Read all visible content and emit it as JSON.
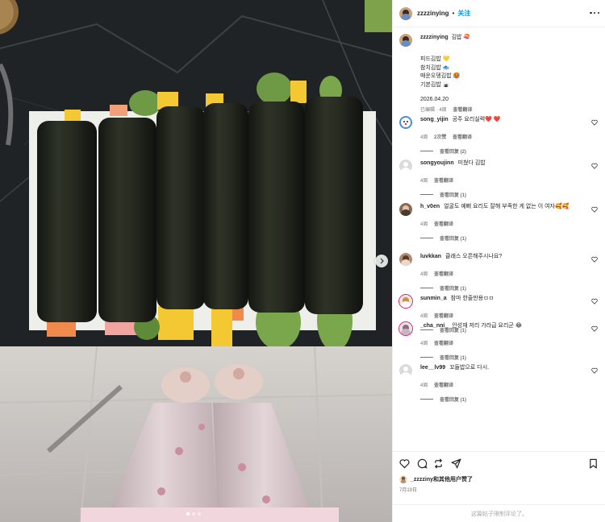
{
  "post": {
    "username": "zzzzinying",
    "separator": "•",
    "follow_label": "关注",
    "caption_title": "김밥 🍣",
    "caption_lines": [
      "피드김밥 💛",
      "참치김밥 🐟",
      "매운오뎅김밥 🥵",
      "기본김밥 🍙"
    ],
    "caption_date": "2026.04.20",
    "caption_edited": "已编辑 · 4周",
    "caption_translate": "查看翻译"
  },
  "comments": [
    {
      "user": "song_yijin",
      "text": "공주 요리실력❤️ ❤️",
      "age": "4周",
      "likes": "2次赞",
      "translate": "查看翻译",
      "replies": "查看回复 (2)"
    },
    {
      "user": "songyoujinn",
      "text": "미쳤다 김밥",
      "age": "4周",
      "translate": "查看翻译",
      "replies": "查看回复 (1)"
    },
    {
      "user": "h_v0en",
      "text": "얼굴도 예뻐 요리도 잘해 부족한 게 없는 이 여자🥰🥰",
      "text2": "🥰🥰",
      "age": "4周",
      "translate": "查看翻译",
      "replies": "查看回复 (1)"
    },
    {
      "user": "luvkkan",
      "text": "클래스 오픈해주시나요?",
      "age": "4周",
      "translate": "查看翻译",
      "replies": "查看回复 (1)"
    },
    {
      "user": "sunmin_a",
      "text": "참마 한줄만용ㅁㅁ",
      "age": "4周",
      "translate": "查看翻译",
      "replies": "查看回复 (1)"
    },
    {
      "user": "_cha_nni_",
      "text": "안성재 저리 가라급 요리군 😂",
      "age": "4周",
      "translate": "查看翻译",
      "replies": "查看回复 (1)"
    },
    {
      "user": "lee__lv99",
      "text": "꼬들밥으로 다시.",
      "age": "4周",
      "translate": "查看翻译",
      "replies": "查看回复 (1)"
    }
  ],
  "footer": {
    "liked_user": "_zzzziny",
    "liked_suffix": "和其他用户赞了",
    "date": "7月19日",
    "comments_disabled": "这篇帖子限制评论了。"
  },
  "colors": {
    "accent": "#0095f6",
    "heart": "#ed4956",
    "muted": "#737373"
  },
  "icons": [
    "more-icon",
    "heart-icon",
    "comment-icon",
    "repost-icon",
    "share-icon",
    "bookmark-icon",
    "chevron-right-icon"
  ]
}
